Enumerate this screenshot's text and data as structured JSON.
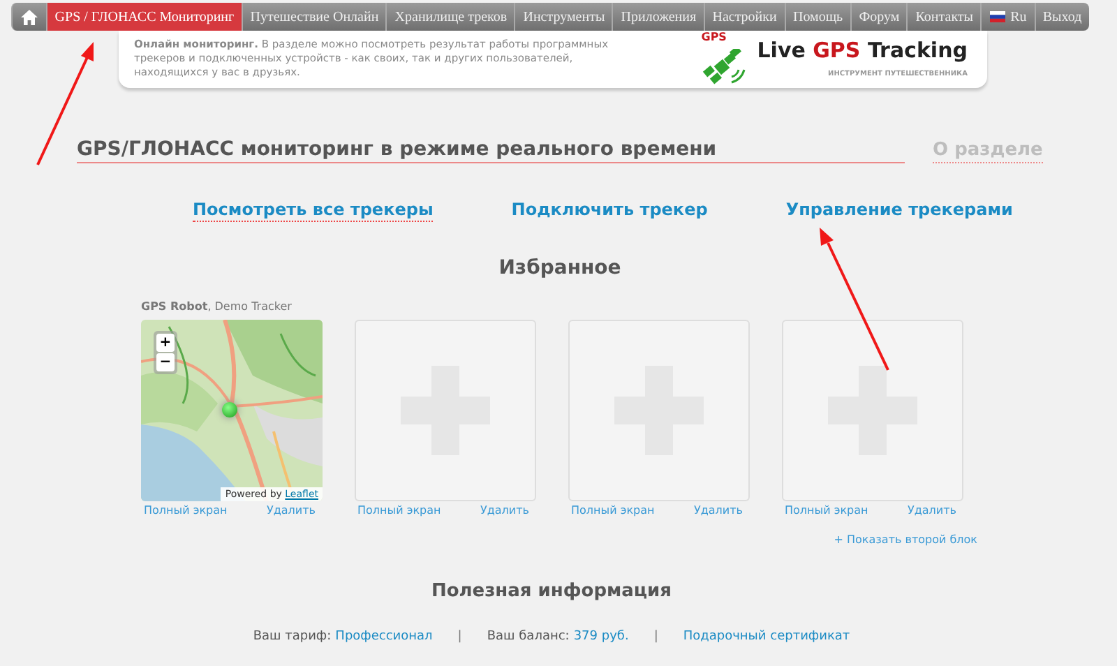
{
  "nav": {
    "items": [
      {
        "kind": "home",
        "selected": false
      },
      {
        "kind": "tab",
        "label": "GPS / ГЛОНАСС Мониторинг",
        "selected": true
      },
      {
        "kind": "tab",
        "label": "Путешествие Онлайн",
        "selected": false
      },
      {
        "kind": "tab",
        "label": "Хранилище треков",
        "selected": false
      },
      {
        "kind": "tab",
        "label": "Инструменты",
        "selected": false
      },
      {
        "kind": "tab",
        "label": "Приложения",
        "selected": false
      },
      {
        "kind": "tab",
        "label": "Настройки",
        "selected": false
      },
      {
        "kind": "tab",
        "label": "Помощь",
        "selected": false
      },
      {
        "kind": "tab",
        "label": "Форум",
        "selected": false
      },
      {
        "kind": "tab",
        "label": "Контакты",
        "selected": false
      },
      {
        "kind": "language",
        "label": "Ru",
        "selected": false
      },
      {
        "kind": "tab",
        "label": "Выход",
        "selected": false
      }
    ]
  },
  "info": {
    "text": "**Онлайн мониторинг.** В разделе можно посмотреть результат работы программных трекеров и подключенных устройств - как своих, так и других пользователей, находящихся у вас в друзьях."
  },
  "logo": {
    "badge": "GPS",
    "title_before": "Live",
    "title_highlight": "GPS",
    "title_after": "Tracking",
    "tagline": "ИНСТРУМЕНТ ПУТЕШЕСТВЕННИКА"
  },
  "page_title": "GPS/ГЛОНАСС мониторинг в режиме реального времени",
  "about_link": "О разделе",
  "actions": [
    {
      "label": "Посмотреть все трекеры",
      "dotted": true
    },
    {
      "label": "Подключить трекер",
      "dotted": false
    },
    {
      "label": "Управление трекерами",
      "dotted": false
    }
  ],
  "favorites": {
    "title": "Избранное",
    "cards": [
      {
        "kind": "map",
        "tracker_label": "**GPS Robot**, Demo Tracker",
        "zoom_in": "+",
        "zoom_out": "−",
        "attribution": "Powered by",
        "attribution_link": "Leaflet",
        "fullscreen": "Полный экран",
        "remove": "Удалить"
      },
      {
        "kind": "empty",
        "fullscreen": "Полный экран",
        "remove": "Удалить"
      },
      {
        "kind": "empty",
        "fullscreen": "Полный экран",
        "remove": "Удалить"
      },
      {
        "kind": "empty",
        "fullscreen": "Полный экран",
        "remove": "Удалить"
      }
    ],
    "show_more": "+ Показать второй блок"
  },
  "useful": {
    "title": "Полезная информация",
    "items": [
      {
        "kind": "pair",
        "label": "Ваш тариф:",
        "value": "Профессионал"
      },
      {
        "kind": "separator",
        "label": "|"
      },
      {
        "kind": "pair",
        "label": "Ваш баланс:",
        "value": "379 руб."
      },
      {
        "kind": "separator",
        "label": "|"
      },
      {
        "kind": "link",
        "label": "Подарочный сертификат"
      }
    ]
  }
}
